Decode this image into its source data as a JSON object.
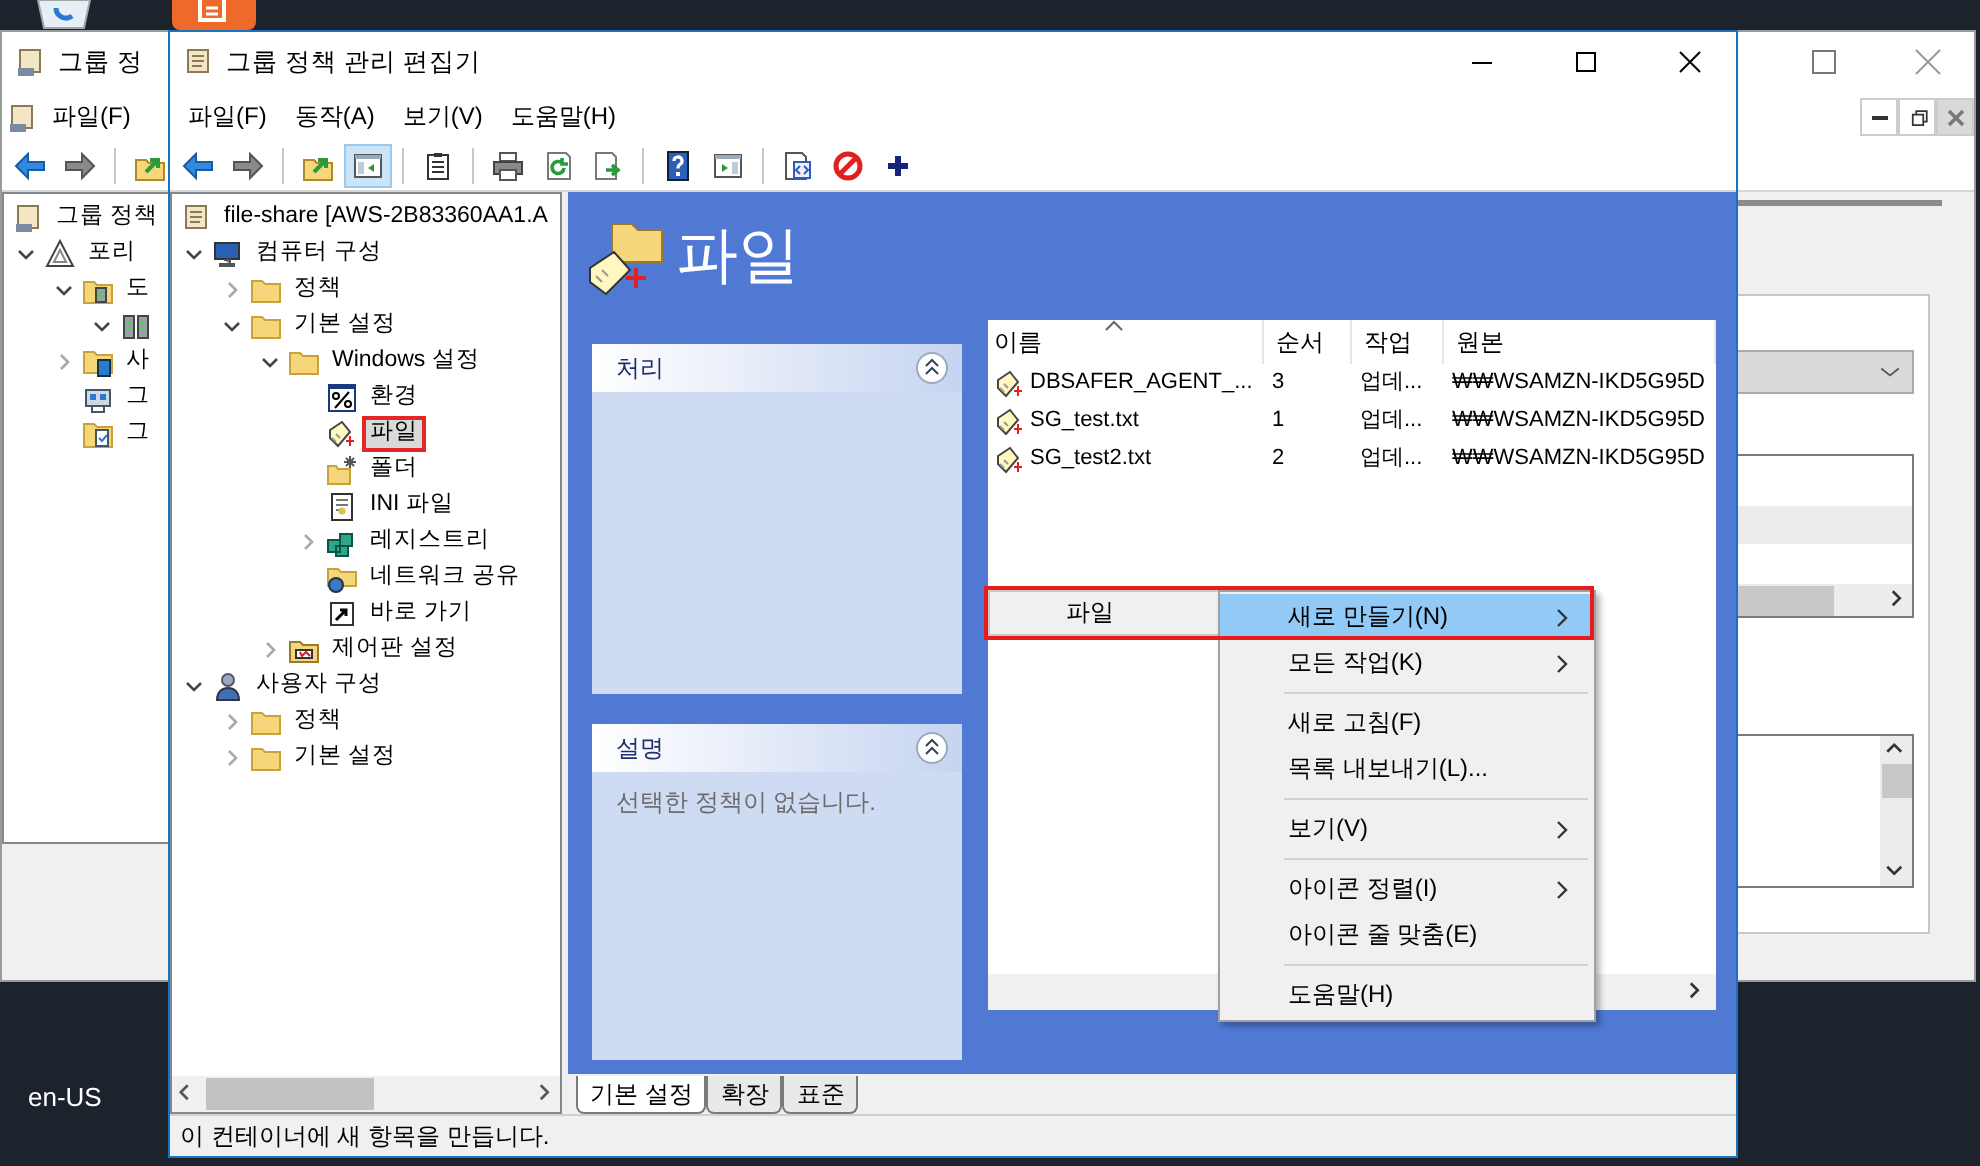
{
  "desktop": {
    "locale": "en-US"
  },
  "background_window": {
    "title": "그룹 정",
    "menu": [
      "파일(F)"
    ],
    "tree": [
      {
        "label": "그룹 정책",
        "kind": "console",
        "children": [
          {
            "label": "포리",
            "kind": "forest",
            "expanded": true,
            "children": [
              {
                "label": "도",
                "kind": "domain",
                "expanded": true,
                "children": [
                  {
                    "kind": "server",
                    "expanded": true
                  }
                ]
              },
              {
                "label": "사",
                "kind": "sites",
                "expanded": false
              },
              {
                "label": "그",
                "kind": "modeling"
              },
              {
                "label": "그",
                "kind": "results"
              }
            ]
          }
        ]
      }
    ]
  },
  "main_window": {
    "title": "그룹 정책 관리 편집기",
    "menu": [
      "파일(F)",
      "동작(A)",
      "보기(V)",
      "도움말(H)"
    ],
    "toolbar": [
      {
        "kind": "back",
        "pressed": false
      },
      {
        "kind": "forward",
        "pressed": false
      },
      {
        "kind": "separator"
      },
      {
        "kind": "up",
        "pressed": false
      },
      {
        "kind": "tree",
        "pressed": true
      },
      {
        "kind": "separator"
      },
      {
        "kind": "clipboard",
        "pressed": false
      },
      {
        "kind": "separator"
      },
      {
        "kind": "print",
        "pressed": false
      },
      {
        "kind": "refresh",
        "pressed": false
      },
      {
        "kind": "export",
        "pressed": false
      },
      {
        "kind": "separator"
      },
      {
        "kind": "help",
        "pressed": false
      },
      {
        "kind": "pane",
        "pressed": false
      },
      {
        "kind": "separator"
      },
      {
        "kind": "properties",
        "pressed": false
      },
      {
        "kind": "block",
        "pressed": false
      },
      {
        "kind": "add",
        "pressed": false
      }
    ],
    "tree": [
      {
        "label": "file-share [AWS-2B83360AA1.A",
        "kind": "scroll",
        "selected": false,
        "children": [
          {
            "label": "컴퓨터 구성",
            "kind": "computer",
            "expanded": true,
            "selected": false,
            "children": [
              {
                "label": "정책",
                "kind": "folder",
                "expanded": false,
                "selected": false
              },
              {
                "label": "기본 설정",
                "kind": "folder",
                "expanded": true,
                "selected": false,
                "children": [
                  {
                    "label": "Windows 설정",
                    "kind": "folder",
                    "expanded": true,
                    "selected": false,
                    "children": [
                      {
                        "label": "환경",
                        "kind": "environment",
                        "selected": false
                      },
                      {
                        "label": "파일",
                        "kind": "file",
                        "selected": true
                      },
                      {
                        "label": "폴더",
                        "kind": "new-folder",
                        "selected": false
                      },
                      {
                        "label": "INI 파일",
                        "kind": "ini",
                        "selected": false
                      },
                      {
                        "label": "레지스트리",
                        "kind": "registry",
                        "expanded": false,
                        "selected": false
                      },
                      {
                        "label": "네트워크 공유",
                        "kind": "network",
                        "selected": false
                      },
                      {
                        "label": "바로 가기",
                        "kind": "shortcut",
                        "selected": false
                      }
                    ]
                  },
                  {
                    "label": "제어판 설정",
                    "kind": "control-panel",
                    "expanded": false,
                    "selected": false
                  }
                ]
              }
            ]
          },
          {
            "label": "사용자 구성",
            "kind": "user",
            "expanded": true,
            "selected": false,
            "children": [
              {
                "label": "정책",
                "kind": "folder",
                "expanded": false,
                "selected": false
              },
              {
                "label": "기본 설정",
                "kind": "folder",
                "expanded": false,
                "selected": false
              }
            ]
          }
        ]
      }
    ],
    "details": {
      "title": "파일",
      "action_panel": {
        "title": "처리"
      },
      "description_panel": {
        "title": "설명",
        "text": "선택한 정책이 없습니다."
      },
      "list": {
        "columns": [
          {
            "label": "이름",
            "sorted_ascending": true
          },
          {
            "label": "순서"
          },
          {
            "label": "작업"
          },
          {
            "label": "원본"
          }
        ],
        "rows": [
          {
            "cells": [
              "DBSAFER_AGENT_...",
              "3",
              "업데...",
              "₩₩WSAMZN-IKD5G95D"
            ]
          },
          {
            "cells": [
              "SG_test.txt",
              "1",
              "업데...",
              "₩₩WSAMZN-IKD5G95D"
            ]
          },
          {
            "cells": [
              "SG_test2.txt",
              "2",
              "업데...",
              "₩₩WSAMZN-IKD5G95D"
            ]
          }
        ]
      }
    },
    "context_menu": {
      "parent_item": {
        "label": "파일"
      },
      "items": [
        {
          "kind": "item",
          "label": "새로 만들기(N)",
          "submenu": true,
          "selected": true
        },
        {
          "kind": "item",
          "label": "모든 작업(K)",
          "submenu": true,
          "selected": false
        },
        {
          "kind": "separator"
        },
        {
          "kind": "item",
          "label": "새로 고침(F)",
          "submenu": false,
          "selected": false
        },
        {
          "kind": "item",
          "label": "목록 내보내기(L)...",
          "submenu": false,
          "selected": false
        },
        {
          "kind": "separator"
        },
        {
          "kind": "item",
          "label": "보기(V)",
          "submenu": true,
          "selected": false
        },
        {
          "kind": "separator"
        },
        {
          "kind": "item",
          "label": "아이콘 정렬(I)",
          "submenu": true,
          "selected": false
        },
        {
          "kind": "item",
          "label": "아이콘 줄 맞춤(E)",
          "submenu": false,
          "selected": false
        },
        {
          "kind": "separator"
        },
        {
          "kind": "item",
          "label": "도움말(H)",
          "submenu": false,
          "selected": false
        }
      ]
    },
    "tabs": [
      {
        "label": "기본 설정",
        "selected": true
      },
      {
        "label": "확장",
        "selected": false
      },
      {
        "label": "표준",
        "selected": false
      }
    ],
    "status_bar": "이 컨테이너에 새 항목을 만듭니다."
  }
}
